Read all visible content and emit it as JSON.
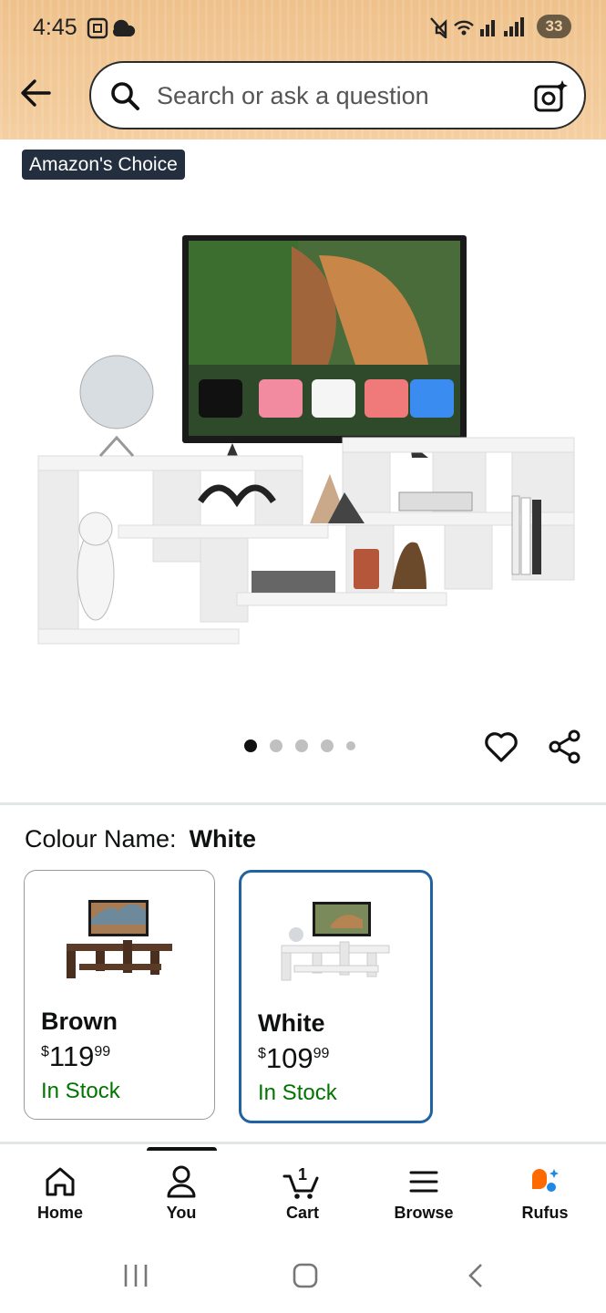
{
  "status_bar": {
    "time": "4:45",
    "battery": "33"
  },
  "search": {
    "placeholder": "Search or ask a question"
  },
  "product": {
    "badge": "Amazon's Choice",
    "image_carousel": {
      "total": 5,
      "active_index": 0
    }
  },
  "colour": {
    "label": "Colour Name:",
    "selected": "White",
    "options": [
      {
        "name": "Brown",
        "currency": "$",
        "price_whole": "119",
        "price_fraction": "99",
        "stock": "In Stock"
      },
      {
        "name": "White",
        "currency": "$",
        "price_whole": "109",
        "price_fraction": "99",
        "stock": "In Stock"
      }
    ]
  },
  "tab_bar": {
    "items": [
      {
        "label": "Home",
        "icon": "home-icon"
      },
      {
        "label": "You",
        "icon": "person-icon"
      },
      {
        "label": "Cart",
        "icon": "cart-icon",
        "badge": "1"
      },
      {
        "label": "Browse",
        "icon": "menu-icon"
      },
      {
        "label": "Rufus",
        "icon": "rufus-icon"
      }
    ],
    "active": "You"
  },
  "colors": {
    "header_bg": "#f2c998",
    "badge_bg": "#232f3e",
    "selected_border": "#2162a1",
    "in_stock": "#007600",
    "rufus_orange": "#ff6a00",
    "rufus_blue": "#1e88e5"
  }
}
